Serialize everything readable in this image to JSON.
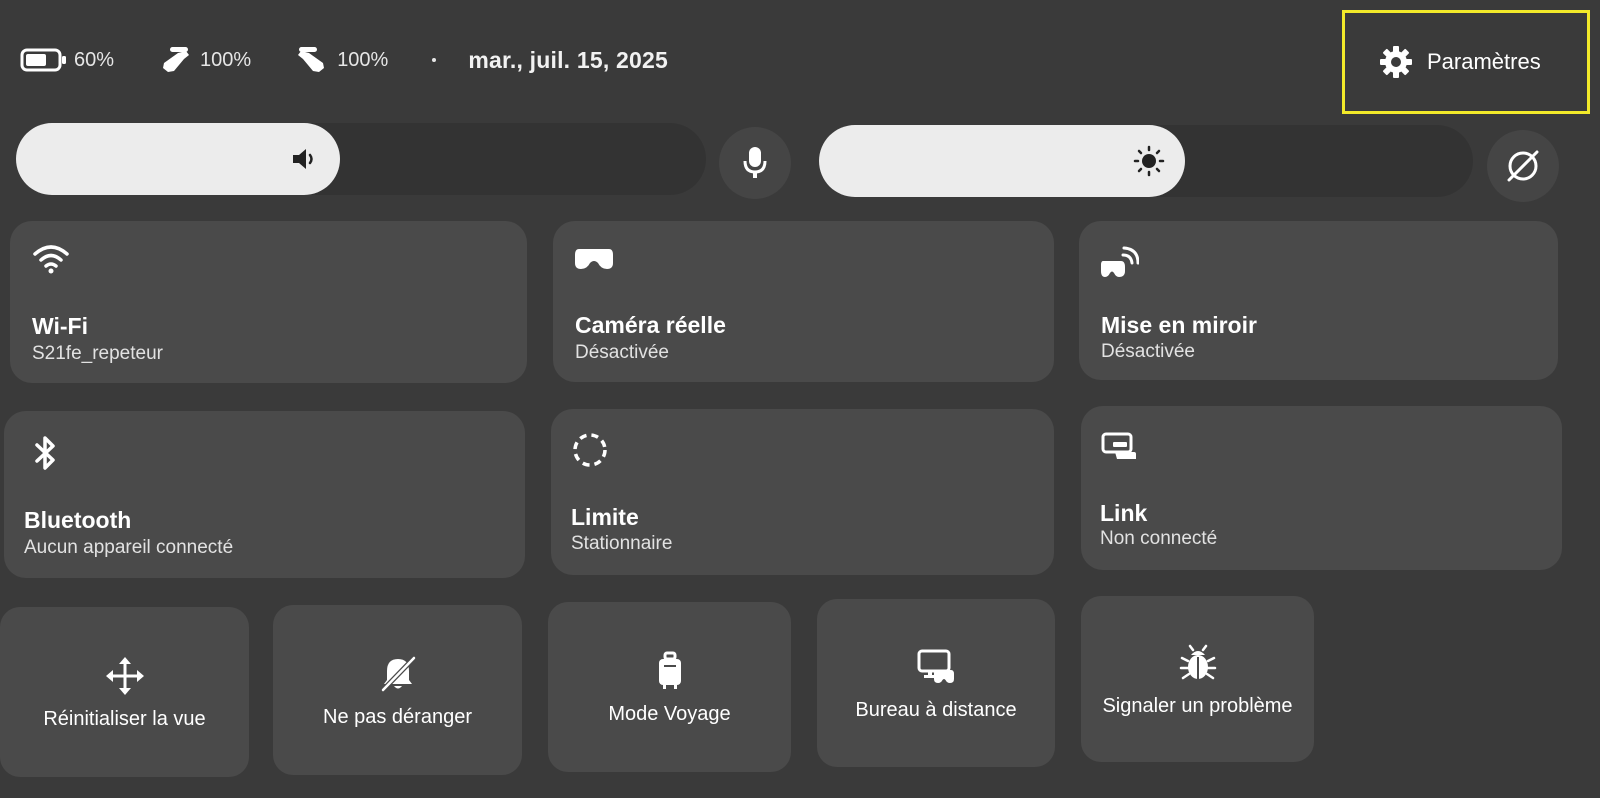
{
  "status_bar": {
    "headset_battery": "60%",
    "left_controller_battery": "100%",
    "right_controller_battery": "100%",
    "date": "mar., juil. 15, 2025"
  },
  "settings": {
    "label": "Paramètres",
    "highlight_color": "#f2e92a"
  },
  "sliders": {
    "volume_level": 0.47,
    "brightness_level": 0.56
  },
  "tiles": {
    "wifi": {
      "title": "Wi-Fi",
      "subtitle": "S21fe_repeteur",
      "icon": "wifi-icon"
    },
    "passthrough": {
      "title": "Caméra réelle",
      "subtitle": "Désactivée",
      "icon": "headset-icon"
    },
    "casting": {
      "title": "Mise en miroir",
      "subtitle": "Désactivée",
      "icon": "cast-icon"
    },
    "bluetooth": {
      "title": "Bluetooth",
      "subtitle": "Aucun appareil connecté",
      "icon": "bluetooth-icon"
    },
    "boundary": {
      "title": "Limite",
      "subtitle": "Stationnaire",
      "icon": "dashed-circle-icon"
    },
    "link": {
      "title": "Link",
      "subtitle": "Non connecté",
      "icon": "link-icon"
    }
  },
  "quick_actions": [
    {
      "label": "Réinitialiser la vue",
      "icon": "move-arrows-icon"
    },
    {
      "label": "Ne pas déranger",
      "icon": "bell-off-icon"
    },
    {
      "label": "Mode Voyage",
      "icon": "luggage-icon"
    },
    {
      "label": "Bureau à distance",
      "icon": "remote-desktop-icon"
    },
    {
      "label": "Signaler un problème",
      "icon": "bug-icon"
    }
  ],
  "colors": {
    "background": "#3a3a3a",
    "tile": "#4a4a4a",
    "slider_fill": "#ececec"
  }
}
